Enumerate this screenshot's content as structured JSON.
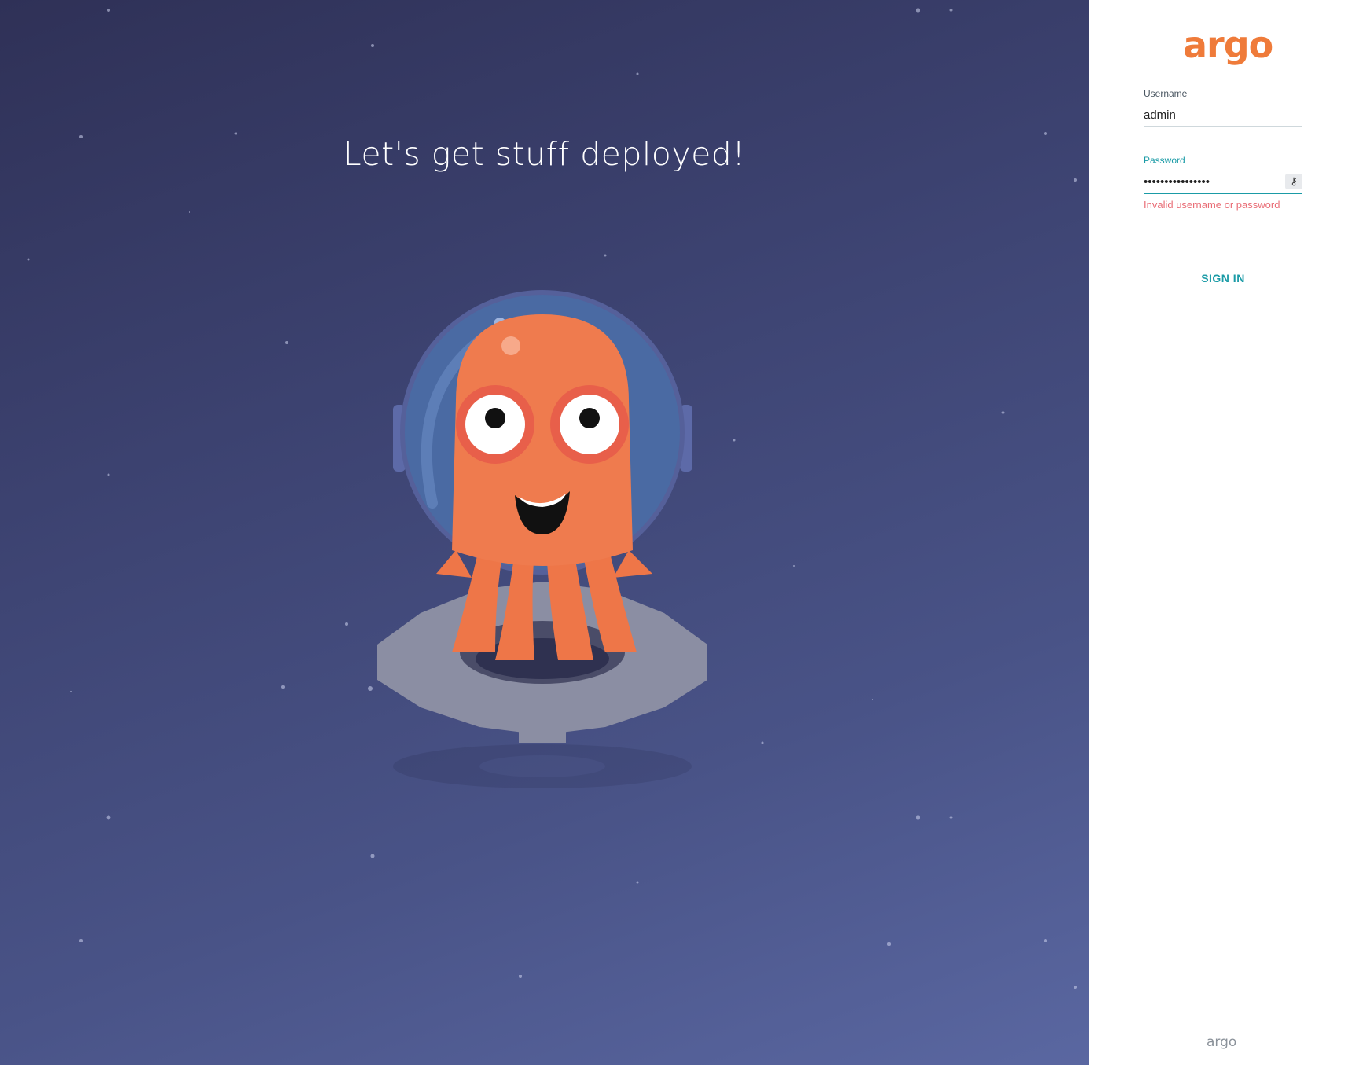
{
  "hero": {
    "title": "Let's get stuff deployed!",
    "mascot_icon": "argo-octopus-astronaut-icon"
  },
  "panel": {
    "logo_text": "argo",
    "username": {
      "label": "Username",
      "value": "admin"
    },
    "password": {
      "label": "Password",
      "masked_value": "••••••••••••••••",
      "key_icon": "key-icon"
    },
    "error": "Invalid username or password",
    "signin_label": "SIGN IN",
    "footer_logo": "argo"
  },
  "colors": {
    "accent": "#1a9ba6",
    "brand": "#ef7b3a",
    "error": "#e96d76",
    "hero_bg_top": "#2f3157",
    "hero_bg_bottom": "#5a67a1"
  }
}
